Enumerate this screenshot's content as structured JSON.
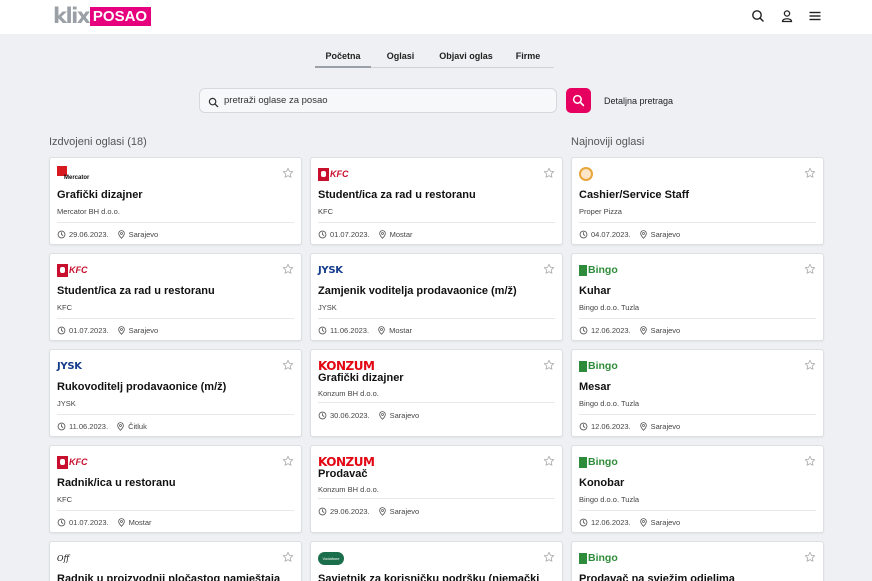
{
  "header": {
    "logo_klix": "klix",
    "logo_posao": "POSAO",
    "icons": [
      "search-icon",
      "user-icon",
      "menu-icon"
    ]
  },
  "nav": {
    "tabs": [
      {
        "label": "Početna",
        "active": true
      },
      {
        "label": "Oglasi",
        "active": false
      },
      {
        "label": "Objavi oglas",
        "active": false
      },
      {
        "label": "Firme",
        "active": false
      }
    ]
  },
  "search": {
    "placeholder": "pretraži oglase za posao",
    "detailed_label": "Detaljna pretraga"
  },
  "sections": {
    "featured_title": "Izdvojeni oglasi (18)",
    "newest_title": "Najnoviji oglasi"
  },
  "colors": {
    "brand_pink": "#e6007e",
    "search_button": "#e6005f",
    "kfc_red": "#c8102e",
    "konzum_red": "#e30613",
    "jysk_blue": "#143c8c",
    "bingo_green": "#2e8b3a"
  },
  "columns": [
    {
      "cards": [
        {
          "logo": "mercator",
          "logo_text": "Mercator",
          "title": "Grafički dizajner",
          "company": "Mercator BH d.o.o.",
          "date": "29.06.2023.",
          "location": "Sarajevo"
        },
        {
          "logo": "kfc",
          "logo_text": "KFC",
          "title": "Student/ica za rad u restoranu",
          "company": "KFC",
          "date": "01.07.2023.",
          "location": "Sarajevo"
        },
        {
          "logo": "jysk",
          "logo_text": "JYSK",
          "title": "Rukovoditelj prodavaonice (m/ž)",
          "company": "JYSK",
          "date": "11.06.2023.",
          "location": "Čitluk"
        },
        {
          "logo": "kfc",
          "logo_text": "KFC",
          "title": "Radnik/ica u restoranu",
          "company": "KFC",
          "date": "01.07.2023.",
          "location": "Mostar"
        },
        {
          "logo": "off",
          "logo_text": "Off",
          "title": "Radnik u proizvodnji pločastog namještaja",
          "company": "",
          "date": "",
          "location": ""
        }
      ]
    },
    {
      "cards": [
        {
          "logo": "kfc",
          "logo_text": "KFC",
          "title": "Student/ica za rad u restoranu",
          "company": "KFC",
          "date": "01.07.2023.",
          "location": "Mostar"
        },
        {
          "logo": "jysk",
          "logo_text": "JYSK",
          "title": "Zamjenik voditelja prodavaonice (m/ž)",
          "company": "JYSK",
          "date": "11.06.2023.",
          "location": "Mostar"
        },
        {
          "logo": "konzum",
          "logo_text": "KONZUM",
          "title": "Grafički dizajner",
          "company": "Konzum BH d.o.o.",
          "date": "30.06.2023.",
          "location": "Sarajevo"
        },
        {
          "logo": "konzum",
          "logo_text": "KONZUM",
          "title": "Prodavač",
          "company": "Konzum BH d.o.o.",
          "date": "29.06.2023.",
          "location": "Sarajevo"
        },
        {
          "logo": "vodafone",
          "logo_text": "Vodafone",
          "title": "Savjetnik za korisničku podršku (njemački",
          "company": "",
          "date": "",
          "location": ""
        }
      ]
    },
    {
      "cards": [
        {
          "logo": "proper",
          "logo_text": "",
          "title": "Cashier/Service Staff",
          "company": "Proper Pizza",
          "date": "04.07.2023.",
          "location": "Sarajevo"
        },
        {
          "logo": "bingo",
          "logo_text": "Bingo",
          "title": "Kuhar",
          "company": "Bingo d.o.o. Tuzla",
          "date": "12.06.2023.",
          "location": "Sarajevo"
        },
        {
          "logo": "bingo",
          "logo_text": "Bingo",
          "title": "Mesar",
          "company": "Bingo d.o.o. Tuzla",
          "date": "12.06.2023.",
          "location": "Sarajevo"
        },
        {
          "logo": "bingo",
          "logo_text": "Bingo",
          "title": "Konobar",
          "company": "Bingo d.o.o. Tuzla",
          "date": "12.06.2023.",
          "location": "Sarajevo"
        },
        {
          "logo": "bingo",
          "logo_text": "Bingo",
          "title": "Prodavač na svježim odjelima",
          "company": "",
          "date": "",
          "location": ""
        }
      ]
    }
  ]
}
